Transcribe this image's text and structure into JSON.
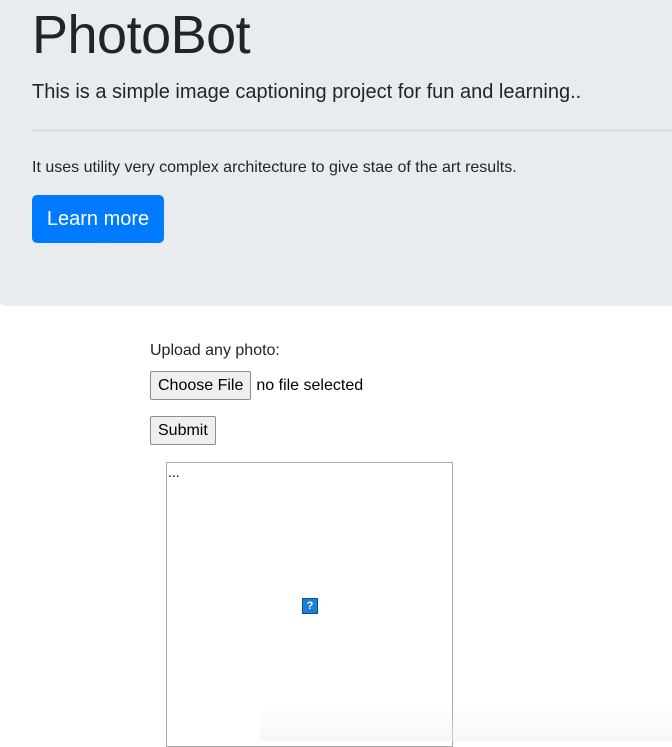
{
  "jumbotron": {
    "title": "PhotoBot",
    "lead": "This is a simple image captioning project for fun and learning..",
    "description": "It uses utility very complex architecture to give stae of the art results.",
    "learn_more_label": "Learn more"
  },
  "form": {
    "upload_label": "Upload any photo:",
    "choose_file_label": "Choose File",
    "file_status": "no file selected",
    "submit_label": "Submit"
  },
  "image_preview": {
    "alt_text": "...",
    "broken_icon_glyph": "?"
  },
  "colors": {
    "jumbotron_bg": "#e9ecef",
    "primary": "#007bff",
    "text": "#212529"
  }
}
